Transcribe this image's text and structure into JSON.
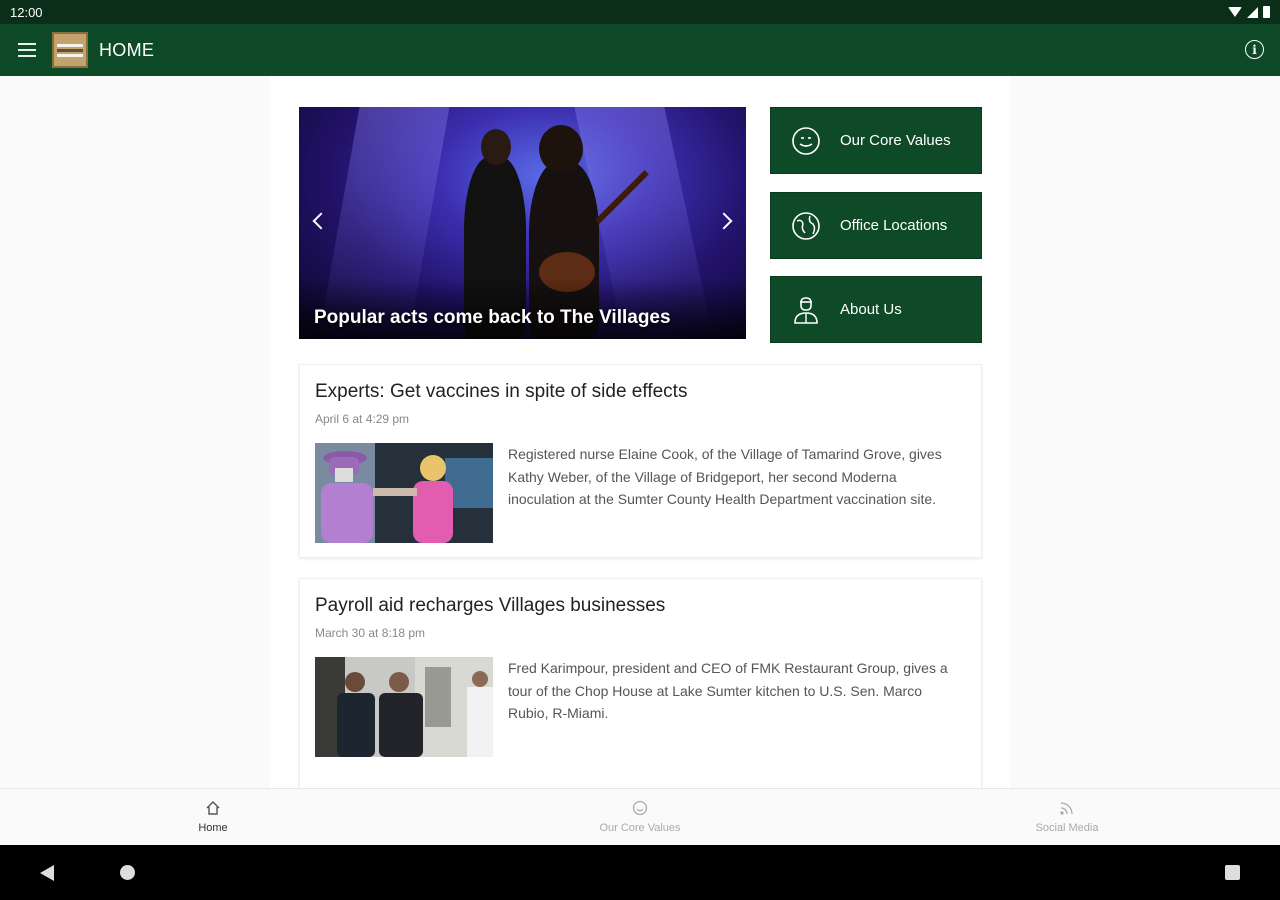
{
  "status_bar": {
    "time": "12:00"
  },
  "app_bar": {
    "title": "HOME"
  },
  "carousel": {
    "caption": "Popular acts come back to The Villages"
  },
  "quick_links": [
    {
      "label": "Our Core Values",
      "icon": "smiley-icon"
    },
    {
      "label": "Office Locations",
      "icon": "globe-icon"
    },
    {
      "label": "About Us",
      "icon": "person-icon"
    }
  ],
  "articles": [
    {
      "title": "Experts: Get vaccines in spite of side effects",
      "date": "April 6 at 4:29 pm",
      "summary": "Registered nurse Elaine Cook, of the Village of Tamarind Grove, gives Kathy Weber, of the Village of Bridgeport, her second Moderna inoculation at the Sumter County Health Department vaccination site."
    },
    {
      "title": "Payroll aid recharges Villages businesses",
      "date": "March 30 at 8:18 pm",
      "summary": "Fred Karimpour, president and CEO of FMK Restaurant Group, gives a tour of the Chop House at Lake Sumter kitchen to U.S. Sen. Marco Rubio, R-Miami."
    }
  ],
  "bottom_nav": [
    {
      "label": "Home",
      "icon": "home-icon",
      "active": true
    },
    {
      "label": "Our Core Values",
      "icon": "smiley-icon",
      "active": false
    },
    {
      "label": "Social Media",
      "icon": "rss-icon",
      "active": false
    }
  ],
  "colors": {
    "primary": "#0f4a28",
    "status_bar": "#0a2e17"
  }
}
